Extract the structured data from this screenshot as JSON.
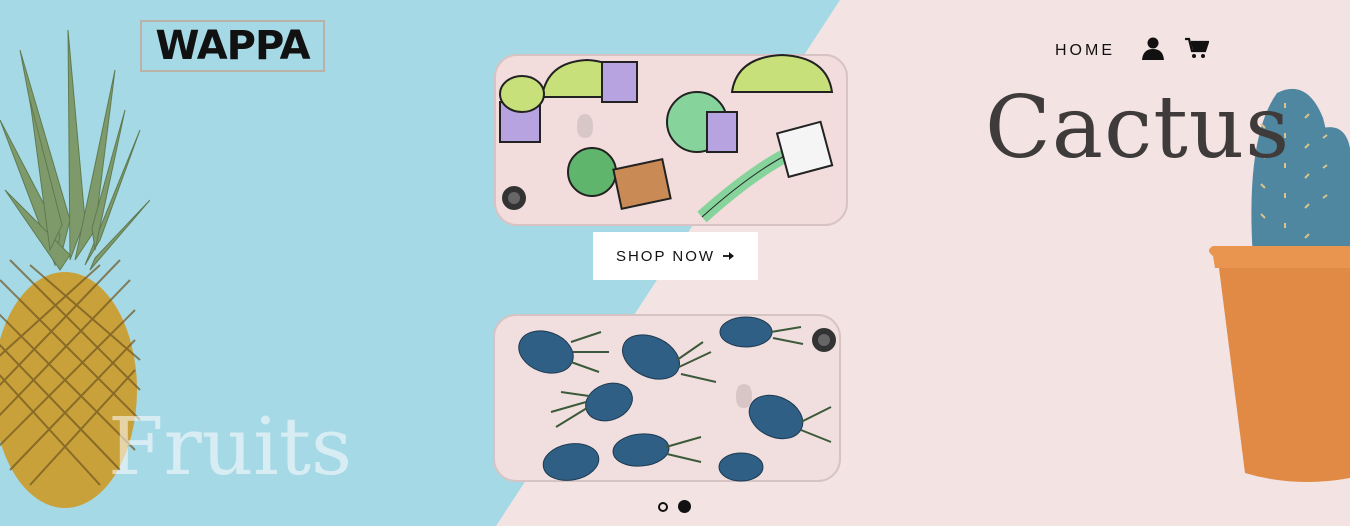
{
  "brand": {
    "logo_text": "WAPPA"
  },
  "nav": {
    "home_label": "HOME",
    "account_icon": "user-icon",
    "cart_icon": "cart-icon"
  },
  "hero": {
    "heading_right": "Cactus",
    "heading_left": "Fruits",
    "cta_label": "SHOP NOW",
    "cta_icon": "arrow-right-icon",
    "slide_count": 2,
    "active_slide": 2
  },
  "colors": {
    "left_bg": "#a6d9e6",
    "right_bg": "#f3e3e3",
    "text_dark": "#111111",
    "pot_orange": "#e18a45"
  }
}
